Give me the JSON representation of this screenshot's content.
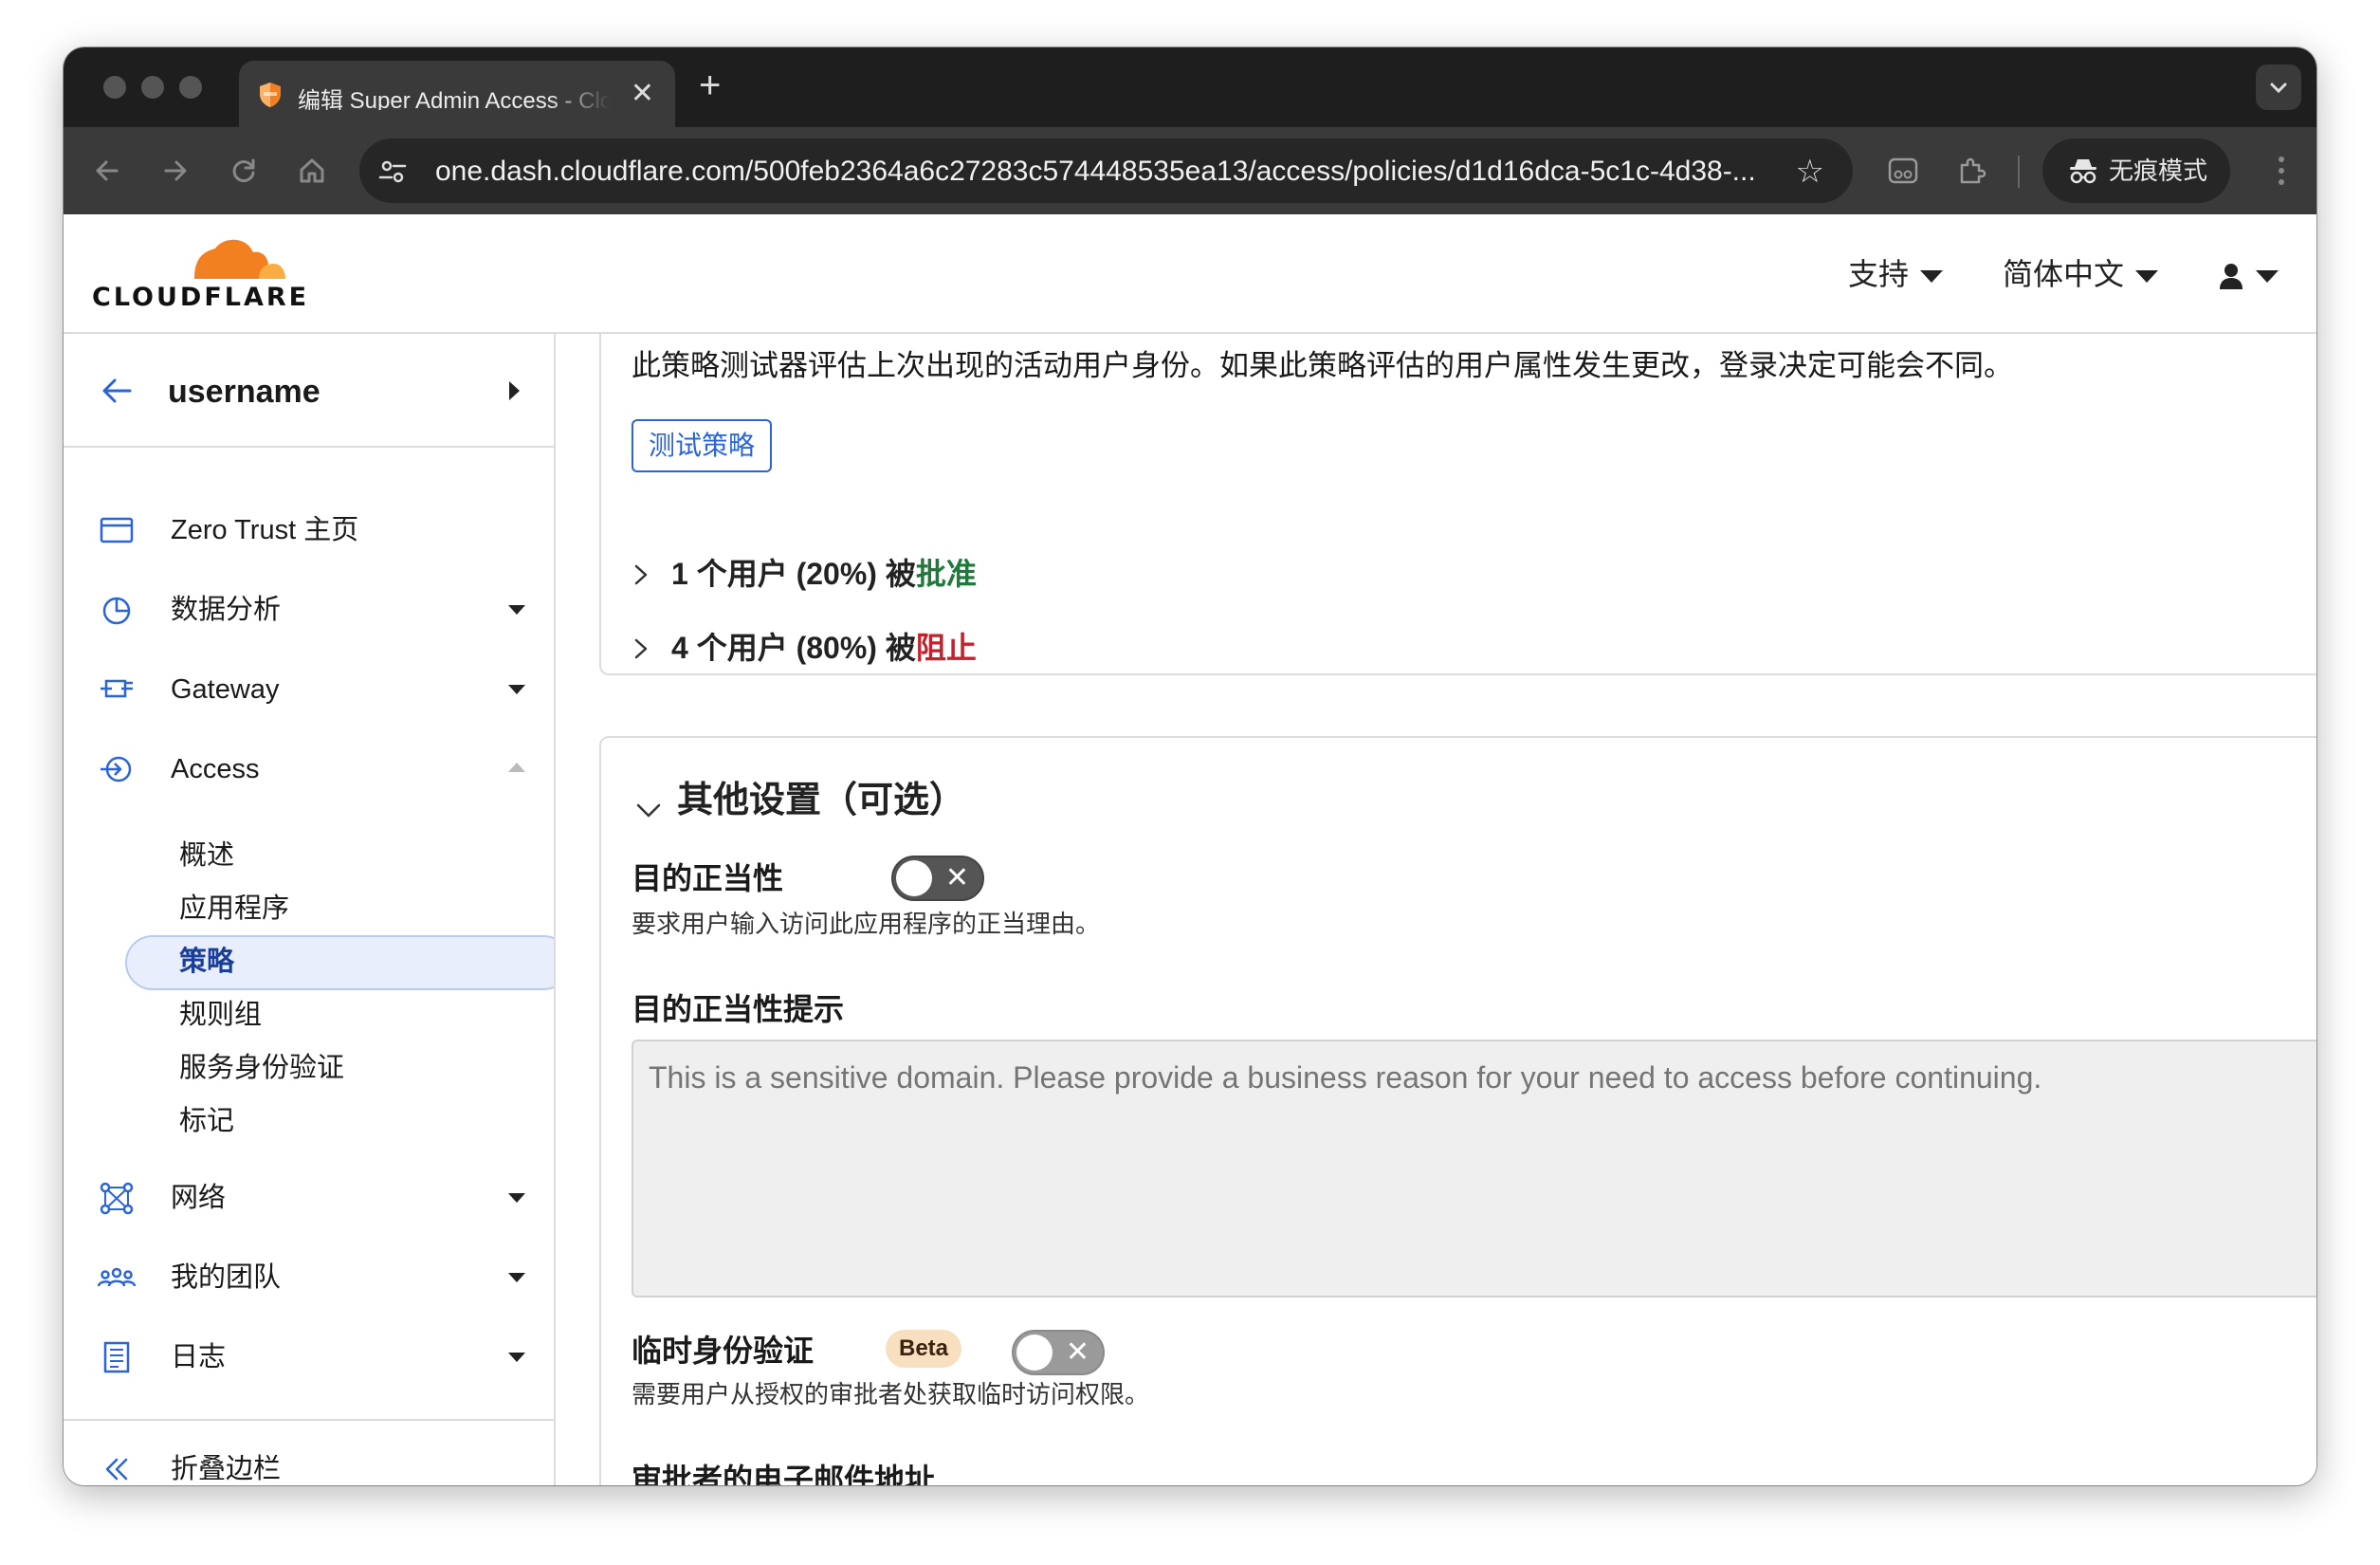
{
  "browser": {
    "tab_title": "编辑 Super Admin Access - Cloudflare Zero Trust",
    "new_tab": "+",
    "close": "✕",
    "url": "one.dash.cloudflare.com/500feb2364a6c27283c574448535ea13/access/policies/d1d16dca-5c1c-4d38-...",
    "incognito_label": "无痕模式"
  },
  "header": {
    "logo_text": "CLOUDFLARE",
    "support": "支持",
    "language": "简体中文",
    "brand_color": "#f38020"
  },
  "sidebar": {
    "account": "username",
    "items": [
      {
        "label": "Zero Trust 主页",
        "icon": "browser-window-icon"
      },
      {
        "label": "数据分析",
        "icon": "pie-chart-icon"
      },
      {
        "label": "Gateway",
        "icon": "gateway-icon"
      },
      {
        "label": "Access",
        "icon": "access-icon"
      },
      {
        "label": "网络",
        "icon": "network-icon"
      },
      {
        "label": "我的团队",
        "icon": "team-icon"
      },
      {
        "label": "日志",
        "icon": "logs-icon"
      }
    ],
    "access_sub": [
      "概述",
      "应用程序",
      "策略",
      "规则组",
      "服务身份验证",
      "标记"
    ],
    "active_sub": "策略",
    "collapse": "折叠边栏"
  },
  "main": {
    "intro": "此策略测试器评估上次出现的活动用户身份。如果此策略评估的用户属性发生更改，登录决定可能会不同。",
    "test_button": "测试策略",
    "results": [
      {
        "prefix": "1 个用户 (20%) 被",
        "status": "批准"
      },
      {
        "prefix": "4 个用户 (80%) 被",
        "status": "阻止"
      }
    ],
    "section_title": "其他设置（可选）",
    "purpose": {
      "label": "目的正当性",
      "desc": "要求用户输入访问此应用程序的正当理由。",
      "enabled": false
    },
    "purpose_prompt": {
      "label": "目的正当性提示",
      "placeholder": "This is a sensitive domain. Please provide a business reason for your need to access before continuing."
    },
    "temp_auth": {
      "label": "临时身份验证",
      "badge": "Beta",
      "desc": "需要用户从授权的审批者处获取临时访问权限。",
      "enabled": false
    },
    "approver_email": {
      "label": "审批者的电子邮件地址"
    }
  }
}
